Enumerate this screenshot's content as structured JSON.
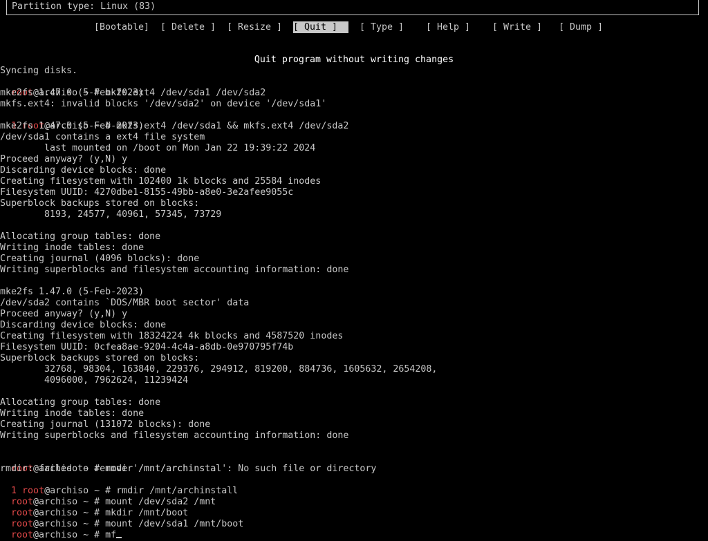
{
  "partition_info": "Partition type: Linux (83)",
  "menu": {
    "bootable": "[Bootable]",
    "delete": "[ Delete ]",
    "resize": "[ Resize ]",
    "quit": "[ Quit ]",
    "type": "[ Type ]",
    "help": "[ Help ]",
    "write": "[ Write ]",
    "dump": "[ Dump ]",
    "selected_description": "Quit program without writing changes"
  },
  "prompt": {
    "user": "root",
    "host_path": "@archiso ~ # ",
    "error_code": "1"
  },
  "terminal": {
    "l00": "Syncing disks.",
    "l01_cmd": "mkfs.ext4 /dev/sda1 /dev/sda2",
    "l02": "mke2fs 1.47.0 (5-Feb-2023)",
    "l03": "mkfs.ext4: invalid blocks '/dev/sda2' on device '/dev/sda1'",
    "l04_cmd": "mkfs.ext4 /dev/sda1 && mkfs.ext4 /dev/sda2",
    "l05": "mke2fs 1.47.0 (5-Feb-2023)",
    "l06": "/dev/sda1 contains a ext4 file system",
    "l07": "        last mounted on /boot on Mon Jan 22 19:39:22 2024",
    "l08": "Proceed anyway? (y,N) y",
    "l09": "Discarding device blocks: done",
    "l10": "Creating filesystem with 102400 1k blocks and 25584 inodes",
    "l11": "Filesystem UUID: 4270dbe1-8155-49bb-a8e0-3e2afee9055c",
    "l12": "Superblock backups stored on blocks:",
    "l13": "        8193, 24577, 40961, 57345, 73729",
    "l14": "",
    "l15": "Allocating group tables: done",
    "l16": "Writing inode tables: done",
    "l17": "Creating journal (4096 blocks): done",
    "l18": "Writing superblocks and filesystem accounting information: done",
    "l19": "",
    "l20": "mke2fs 1.47.0 (5-Feb-2023)",
    "l21": "/dev/sda2 contains `DOS/MBR boot sector' data",
    "l22": "Proceed anyway? (y,N) y",
    "l23": "Discarding device blocks: done",
    "l24": "Creating filesystem with 18324224 4k blocks and 4587520 inodes",
    "l25": "Filesystem UUID: 0cfea8ae-9204-4c4a-a8db-0e970795f74b",
    "l26": "Superblock backups stored on blocks:",
    "l27": "        32768, 98304, 163840, 229376, 294912, 819200, 884736, 1605632, 2654208,",
    "l28": "        4096000, 7962624, 11239424",
    "l29": "",
    "l30": "Allocating group tables: done",
    "l31": "Writing inode tables: done",
    "l32": "Creating journal (131072 blocks): done",
    "l33": "Writing superblocks and filesystem accounting information: done",
    "l34": "",
    "l35_cmd": "rmdir /mnt/archinstal",
    "l36": "rmdir: failed to remove '/mnt/archinstal': No such file or directory",
    "l37_cmd": "rmdir /mnt/archinstall",
    "l38_cmd": "mount /dev/sda2 /mnt",
    "l39_cmd": "mkdir /mnt/boot",
    "l40_cmd": "mount /dev/sda1 /mnt/boot",
    "l41_cmd": "mf"
  },
  "colors": {
    "background": "#000000",
    "foreground": "#c8c8c8",
    "prompt_user": "#e04848",
    "selected_bg": "#c8c8c8"
  }
}
